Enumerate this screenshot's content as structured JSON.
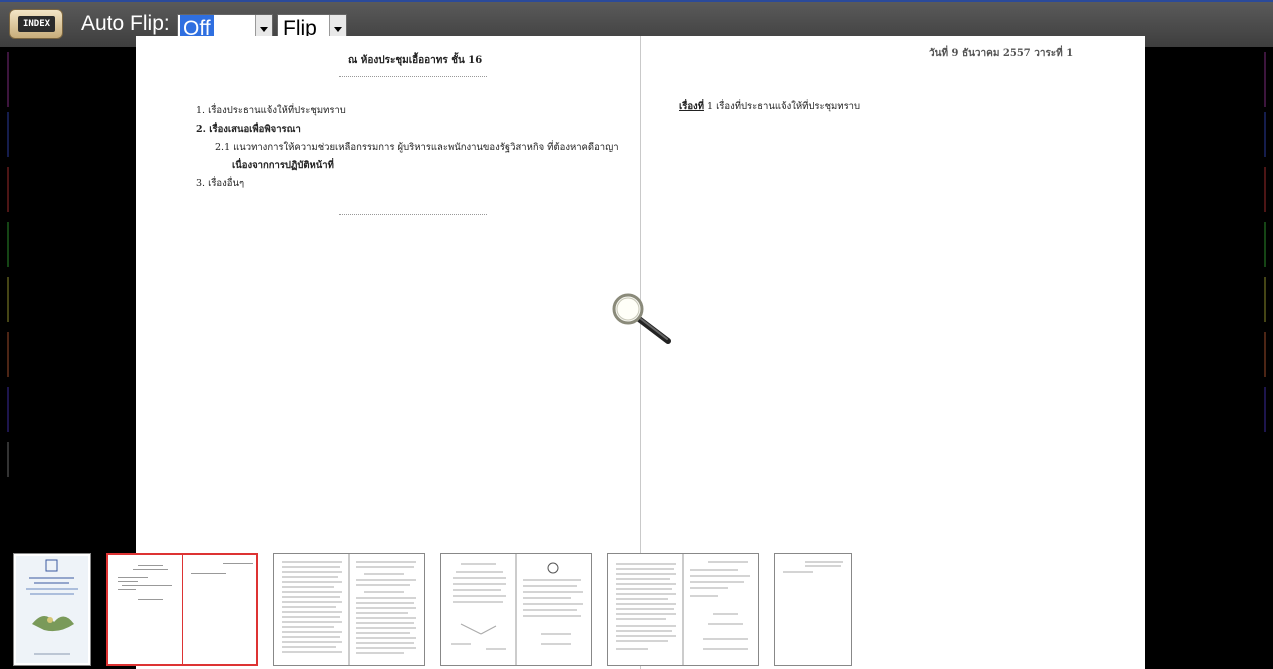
{
  "toolbar": {
    "index_label": "INDEX",
    "auto_flip_label": "Auto Flip:",
    "auto_flip_value": "Off",
    "flip_value": "Flip"
  },
  "left_page": {
    "header": "ณ  ห้องประชุมเอื้ออาทร ชั้น 16",
    "item1": "1.  เรื่องประธานแจ้งให้ที่ประชุมทราบ",
    "item2": "2.  เรื่องเสนอเพื่อพิจารณา",
    "item2_1a": "2.1  แนวทางการให้ความช่วยเหลือกรรมการ ผู้บริหารและพนักงานของรัฐวิสาหกิจ ที่ต้องหาคดีอาญา",
    "item2_1b": "เนื่องจากการปฏิบัติหน้าที่",
    "item3": "3.  เรื่องอื่นๆ"
  },
  "right_page": {
    "date_line": "วันที่ 9  ธันวาคม  2557  วาระที่ 1",
    "topic_label": "เรื่องที่",
    "topic_text": "1  เรื่องที่ประธานแจ้งให้ที่ประชุมทราบ"
  },
  "thumbnails": [
    {
      "id": "cover",
      "active": false
    },
    {
      "id": "pages-2-3",
      "active": true
    },
    {
      "id": "pages-4-5",
      "active": false
    },
    {
      "id": "pages-6-7",
      "active": false
    },
    {
      "id": "pages-8-9",
      "active": false
    },
    {
      "id": "page-10",
      "active": false
    }
  ],
  "colors": {
    "toolbar_bg": "#4a4a4a",
    "select_highlight": "#2f6fe0",
    "active_thumb_border": "#dd3333",
    "background": "#000000"
  }
}
